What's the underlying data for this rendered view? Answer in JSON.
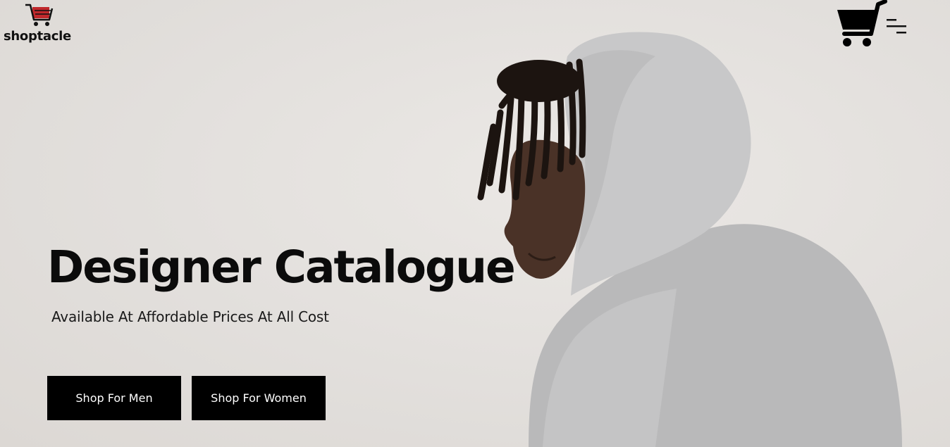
{
  "header": {
    "logo_text": "shoptacle",
    "logo_icon": "cart-logo-icon",
    "cart_icon": "shopping-cart-icon",
    "menu_icon": "hamburger-menu-icon"
  },
  "hero": {
    "title": "Designer Catalogue",
    "subtitle": "Available At Affordable Prices At All Cost",
    "buttons": {
      "men_label": "Shop For Men",
      "women_label": "Shop For Women"
    }
  },
  "colors": {
    "background": "#e3e0dd",
    "button_bg": "#000000",
    "button_text": "#ffffff",
    "logo_accent": "#c0282c"
  }
}
